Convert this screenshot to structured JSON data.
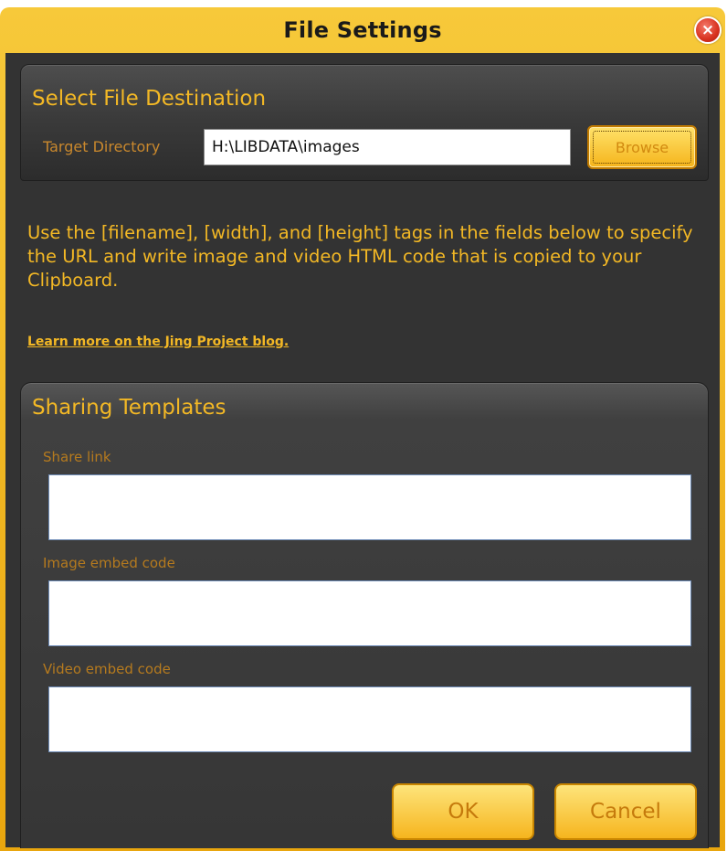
{
  "window": {
    "title": "File Settings",
    "close_icon": "close-icon",
    "close_glyph": "×"
  },
  "destination": {
    "title": "Select File Destination",
    "target_label": "Target Directory",
    "target_value": "H:\\LIBDATA\\images",
    "browse_label": "Browse"
  },
  "info": {
    "text": "Use the [filename], [width], and [height] tags in the fields below to specify the URL and write image and video HTML code that is copied to your Clipboard.",
    "link_text": "Learn more on the Jing Project blog."
  },
  "templates": {
    "title": "Sharing Templates",
    "fields": [
      {
        "label": "Share link",
        "value": ""
      },
      {
        "label": "Image embed code",
        "value": ""
      },
      {
        "label": "Video embed code",
        "value": ""
      }
    ]
  },
  "actions": {
    "ok_label": "OK",
    "cancel_label": "Cancel"
  },
  "colors": {
    "accent": "#f3b825",
    "frame": "#f0b520",
    "background": "#333333",
    "close_button": "#d8321f"
  }
}
